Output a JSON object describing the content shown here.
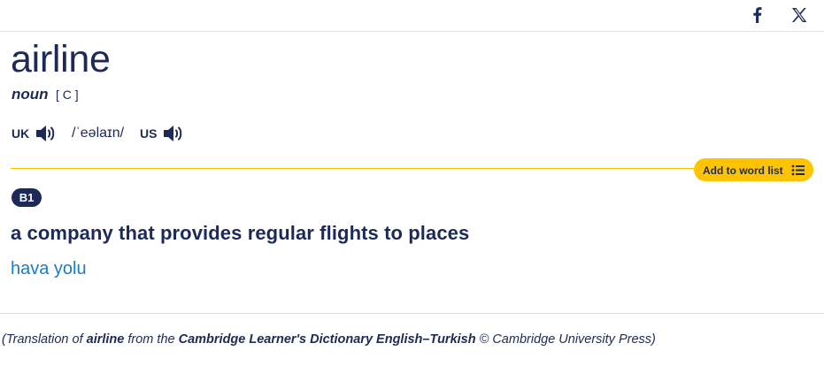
{
  "share": {
    "icons": [
      "facebook-icon",
      "x-twitter-icon"
    ]
  },
  "entry": {
    "headword": "airline",
    "pos": "noun",
    "grammar": "[ C ]",
    "pronunciation": {
      "uk_label": "UK",
      "us_label": "US",
      "ipa": "/ˈeəlaɪn/"
    },
    "add_to_word_list": "Add to word list",
    "level": "B1",
    "definition": "a company that provides regular flights to places",
    "translation": "hava yolu"
  },
  "credit": {
    "open": "(Translation of ",
    "word": "airline",
    "middle": " from the ",
    "dictionary": "Cambridge Learner's Dictionary English–Turkish",
    "close": " © Cambridge University Press)"
  },
  "colors": {
    "primary": "#1d2a57",
    "accent_yellow": "#fec400",
    "translation_blue": "#1a7dc2"
  }
}
